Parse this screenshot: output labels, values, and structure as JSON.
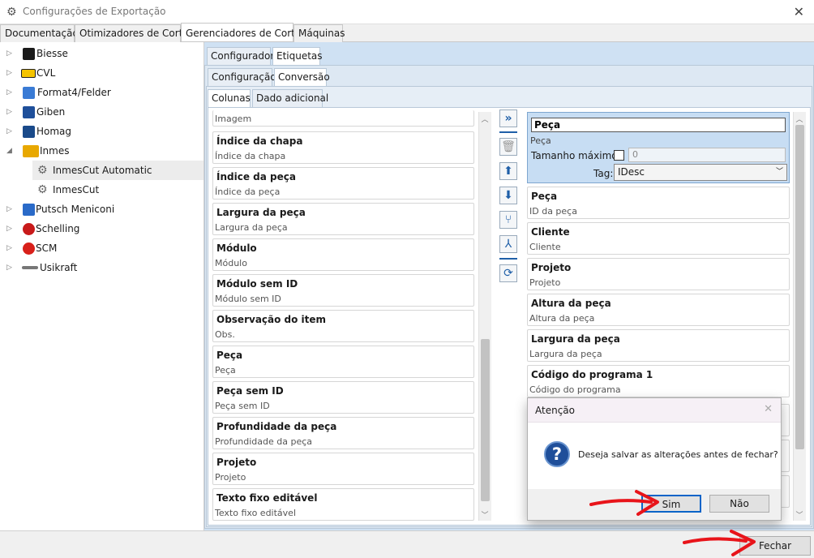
{
  "window": {
    "title": "Configurações de Exportação",
    "close_glyph": "✕"
  },
  "main_tabs": [
    "Documentação",
    "Otimizadores de Corte",
    "Gerenciadores de Corte",
    "Máquinas"
  ],
  "tree": {
    "items": [
      {
        "label": "Biesse",
        "icon": "biesse-logo-icon",
        "color": "#1a1a1a"
      },
      {
        "label": "CVL",
        "icon": "cvl-logo-icon",
        "color": "#f5c400"
      },
      {
        "label": "Format4/Felder",
        "icon": "format4-logo-icon",
        "color": "#3a7bd5"
      },
      {
        "label": "Giben",
        "icon": "giben-logo-icon",
        "color": "#1f4f9a"
      },
      {
        "label": "Homag",
        "icon": "homag-logo-icon",
        "color": "#1a4a8a"
      },
      {
        "label": "Inmes",
        "icon": "inmes-logo-icon",
        "color": "#e8a800"
      },
      {
        "label": "InmesCut Automatic",
        "icon": "gear-icon"
      },
      {
        "label": "InmesCut",
        "icon": "gear-icon"
      },
      {
        "label": "Putsch Meniconi",
        "icon": "putsch-logo-icon",
        "color": "#2a6ac8"
      },
      {
        "label": "Schelling",
        "icon": "schelling-logo-icon",
        "color": "#c81a1a"
      },
      {
        "label": "SCM",
        "icon": "scm-logo-icon",
        "color": "#d8201a"
      },
      {
        "label": "Usikraft",
        "icon": "usikraft-logo-icon",
        "color": "#777777"
      }
    ]
  },
  "sub_tabs_1": [
    "Configurador",
    "Etiquetas"
  ],
  "sub_tabs_2": [
    "Configuração",
    "Conversão"
  ],
  "sub_tabs_3": [
    "Colunas",
    "Dado adicional"
  ],
  "left_list": {
    "partial_label": "Imagem",
    "cards": [
      {
        "title": "Índice da chapa",
        "sub": "Índice da chapa"
      },
      {
        "title": "Índice da peça",
        "sub": "Índice da peça"
      },
      {
        "title": "Largura da peça",
        "sub": "Largura da peça"
      },
      {
        "title": "Módulo",
        "sub": "Módulo"
      },
      {
        "title": "Módulo sem ID",
        "sub": "Módulo sem ID"
      },
      {
        "title": "Observação do item",
        "sub": "Obs."
      },
      {
        "title": "Peça",
        "sub": "Peça"
      },
      {
        "title": "Peça sem ID",
        "sub": "Peça sem ID"
      },
      {
        "title": "Profundidade da peça",
        "sub": "Profundidade da peça"
      },
      {
        "title": "Projeto",
        "sub": "Projeto"
      },
      {
        "title": "Texto fixo editável",
        "sub": "Texto fixo editável"
      }
    ]
  },
  "toolbar": {
    "icons": [
      "add-all-icon",
      "delete-icon",
      "move-up-icon",
      "move-down-icon",
      "merge-icon",
      "split-icon",
      "refresh-icon"
    ]
  },
  "selected_item": {
    "name_value": "Peça",
    "sub": "Peça",
    "max_size_label": "Tamanho máximo:",
    "max_size_value": "0",
    "tag_label": "Tag:",
    "tag_value": "IDesc"
  },
  "right_list": {
    "cards": [
      {
        "title": "Peça",
        "sub": "ID da peça"
      },
      {
        "title": "Cliente",
        "sub": "Cliente"
      },
      {
        "title": "Projeto",
        "sub": "Projeto"
      },
      {
        "title": "Altura da peça",
        "sub": "Altura da peça"
      },
      {
        "title": "Largura da peça",
        "sub": "Largura da peça"
      },
      {
        "title": "Código do programa 1",
        "sub": "Código do programa"
      }
    ]
  },
  "dialog": {
    "title": "Atenção",
    "message": "Deseja salvar as alterações antes de fechar?",
    "yes_label": "Sim",
    "no_label": "Não",
    "close_glyph": "✕"
  },
  "footer": {
    "close_label": "Fechar"
  },
  "colors": {
    "accent": "#1f5fa8",
    "annotation_arrow": "#e8141a"
  }
}
